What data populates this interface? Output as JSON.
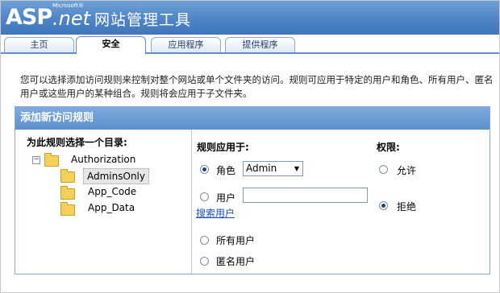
{
  "header": {
    "logo_asp": "ASP",
    "logo_net": ".net",
    "logo_ms": "Microsoft®",
    "title": "网站管理工具"
  },
  "tabs": [
    {
      "label": "主页"
    },
    {
      "label": "安全"
    },
    {
      "label": "应用程序"
    },
    {
      "label": "提供程序"
    }
  ],
  "description": "您可以选择添加访问规则来控制对整个网站或单个文件夹的访问。规则可应用于特定的用户和角色、所有用户、匿名用户或这些用户的某种组合。规则将会应用于子文件夹。",
  "panel": {
    "title": "添加新访问规则",
    "folder_col_title": "为此规则选择一个目录:",
    "tree": {
      "root": "Authorization",
      "children": [
        "AdminsOnly",
        "App_Code",
        "App_Data"
      ]
    },
    "apply_col_title": "规则应用于:",
    "role_label": "角色",
    "role_value": "Admin",
    "user_label": "用户",
    "user_value": "",
    "search_users_link": "搜索用户",
    "all_users_label": "所有用户",
    "anon_users_label": "匿名用户",
    "perm_col_title": "权限:",
    "allow_label": "允许",
    "deny_label": "拒绝"
  }
}
